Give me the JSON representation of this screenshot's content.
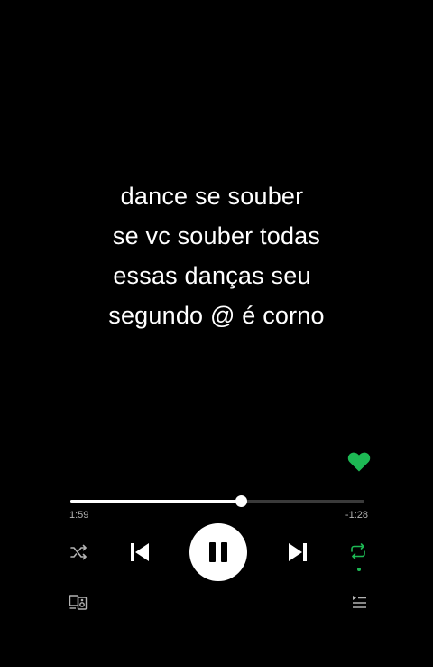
{
  "lyrics": {
    "lines": [
      "dance se souber",
      "se vc souber todas",
      "essas danças seu",
      "segundo @ é corno"
    ]
  },
  "player": {
    "liked": true,
    "elapsed": "1:59",
    "remaining": "-1:28",
    "progress_fraction": 0.58,
    "state": "playing",
    "shuffle": false,
    "repeat": true
  },
  "icons": {
    "heart": "heart-icon",
    "shuffle": "shuffle-icon",
    "previous": "skip-previous-icon",
    "pause": "pause-icon",
    "next": "skip-next-icon",
    "repeat": "repeat-icon",
    "devices": "connect-devices-icon",
    "queue": "queue-icon"
  },
  "colors": {
    "background": "#000000",
    "text": "#ffffff",
    "accent": "#1db954",
    "muted": "#b3b3b3"
  }
}
